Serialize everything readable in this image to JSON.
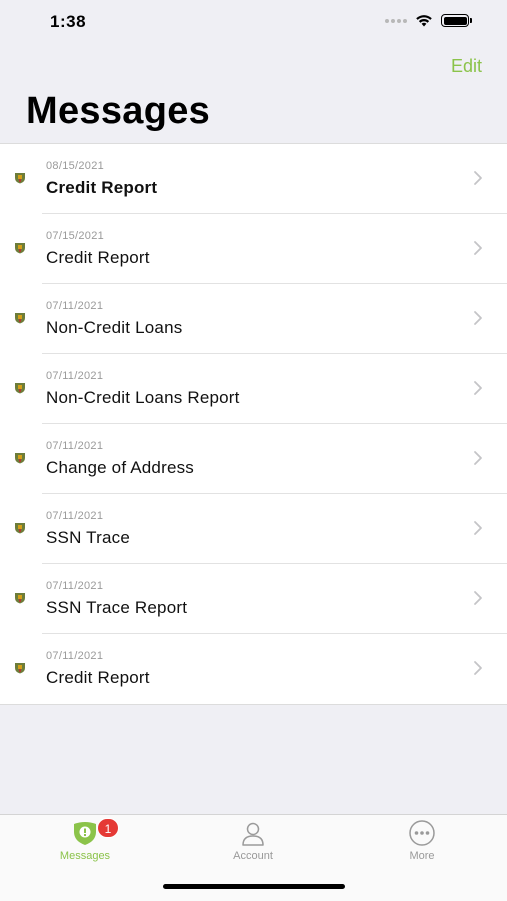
{
  "status_bar": {
    "time": "1:38"
  },
  "header": {
    "edit_label": "Edit",
    "title": "Messages"
  },
  "messages": [
    {
      "date": "08/15/2021",
      "title": "Credit Report",
      "unread": true
    },
    {
      "date": "07/15/2021",
      "title": "Credit Report",
      "unread": false
    },
    {
      "date": "07/11/2021",
      "title": "Non-Credit Loans",
      "unread": false
    },
    {
      "date": "07/11/2021",
      "title": "Non-Credit Loans Report",
      "unread": false
    },
    {
      "date": "07/11/2021",
      "title": "Change of Address",
      "unread": false
    },
    {
      "date": "07/11/2021",
      "title": "SSN Trace",
      "unread": false
    },
    {
      "date": "07/11/2021",
      "title": "SSN Trace Report",
      "unread": false
    },
    {
      "date": "07/11/2021",
      "title": "Credit Report",
      "unread": false
    }
  ],
  "tab_bar": {
    "tabs": [
      {
        "label": "Messages",
        "icon": "shield-alert-icon",
        "active": true,
        "badge": "1"
      },
      {
        "label": "Account",
        "icon": "person-icon",
        "active": false
      },
      {
        "label": "More",
        "icon": "ellipsis-circle-icon",
        "active": false
      }
    ]
  },
  "colors": {
    "accent": "#8bc34a",
    "badge": "#e53935",
    "background": "#efeff4"
  }
}
